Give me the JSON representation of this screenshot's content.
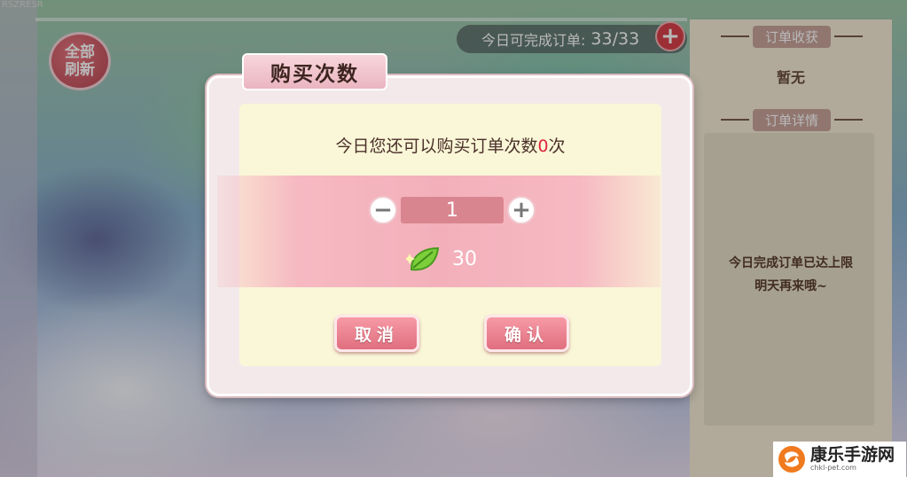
{
  "background": {
    "corner_text": "RSZRESR"
  },
  "top_left": {
    "refresh_label": "全部\n刷新"
  },
  "order_counter": {
    "label": "今日可完成订单:",
    "value": "33/33",
    "plus_icon": "plus-icon"
  },
  "right_panel": {
    "rewards_header": "订单收获",
    "rewards_value": "暂无",
    "details_header": "订单详情",
    "details_message_line1": "今日完成订单已达上限",
    "details_message_line2": "明天再来哦~"
  },
  "dialog": {
    "title": "购买次数",
    "prompt_prefix": "今日您还可以购买订单次数",
    "prompt_count": "0",
    "prompt_suffix": "次",
    "minus_icon": "minus-icon",
    "quantity": "1",
    "plus_icon": "plus-icon",
    "currency_icon": "leaf-icon",
    "cost": "30",
    "cancel_label": "取消",
    "confirm_label": "确认"
  },
  "watermark": {
    "name": "康乐手游网",
    "url": "chkl-pet.com"
  },
  "colors": {
    "accent_red": "#e0243c",
    "button_pink": "#e06f7e",
    "panel_cream": "#faf6d8"
  }
}
